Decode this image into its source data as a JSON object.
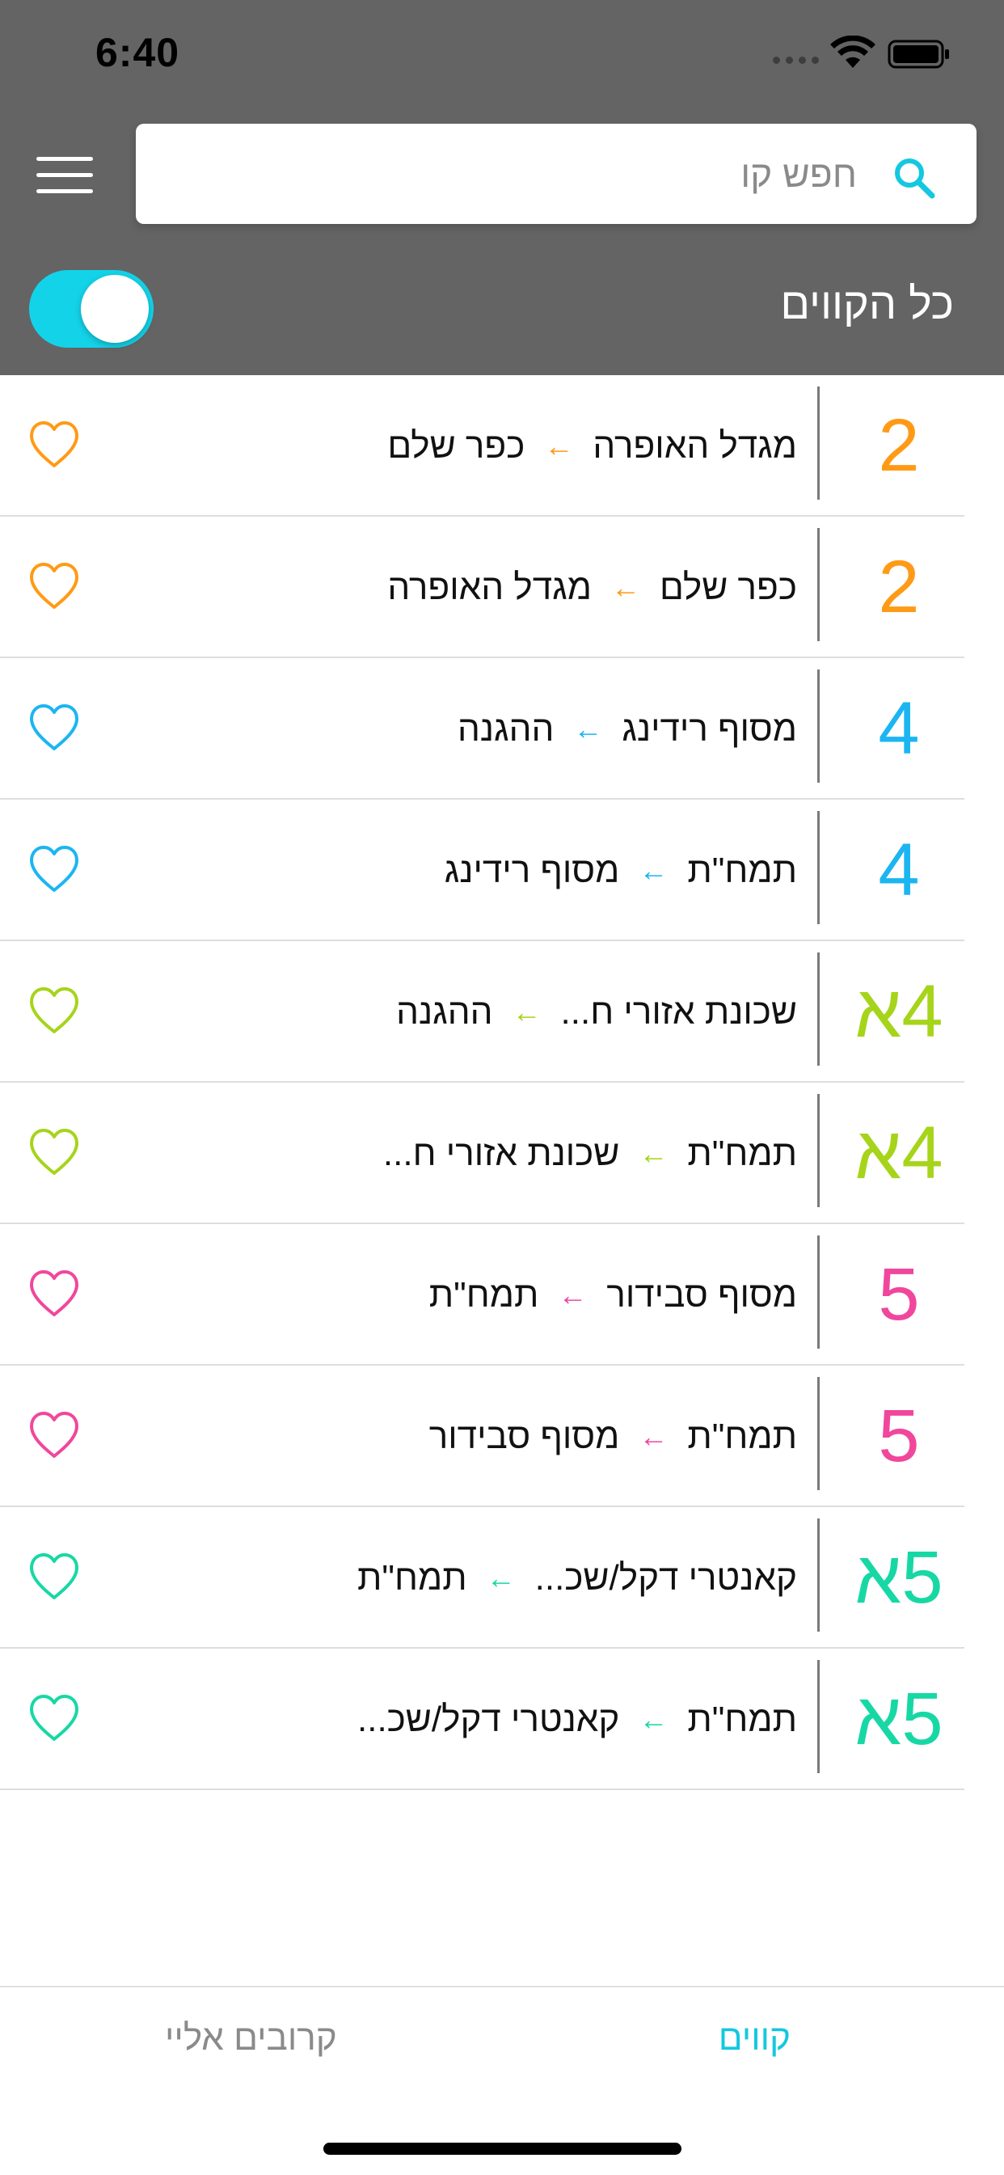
{
  "status_bar": {
    "time": "6:40"
  },
  "search": {
    "placeholder": "חפש קו",
    "value": "",
    "icon": "search-icon"
  },
  "filter": {
    "label": "כל הקווים",
    "toggle_on": true
  },
  "colors": {
    "header_bg": "#646464",
    "accent": "#13d3e9",
    "line_2": "#ff9a16",
    "line_4": "#1cb5f2",
    "line_4a": "#a6d41a",
    "line_5": "#f0479c",
    "line_5a": "#17d8a5"
  },
  "lines": [
    {
      "number": "2",
      "from": "מגדל האופרה",
      "to": "כפר שלם",
      "color": "#ff9a16"
    },
    {
      "number": "2",
      "from": "כפר שלם",
      "to": "מגדל האופרה",
      "color": "#ff9a16"
    },
    {
      "number": "4",
      "from": "מסוף רידינג",
      "to": "ההגנה",
      "color": "#1cb5f2"
    },
    {
      "number": "4",
      "from": "תמח\"ת",
      "to": "מסוף רידינג",
      "color": "#1cb5f2"
    },
    {
      "number": "4א",
      "from": "שכונת אזורי ח...",
      "to": "ההגנה",
      "color": "#a6d41a"
    },
    {
      "number": "4א",
      "from": "תמח\"ת",
      "to": "שכונת אזורי ח...",
      "color": "#a6d41a"
    },
    {
      "number": "5",
      "from": "מסוף סבידור",
      "to": "תמח\"ת",
      "color": "#f0479c"
    },
    {
      "number": "5",
      "from": "תמח\"ת",
      "to": "מסוף סבידור",
      "color": "#f0479c"
    },
    {
      "number": "5א",
      "from": "קאנטרי דקל/שכ...",
      "to": "תמח\"ת",
      "color": "#17d8a5"
    },
    {
      "number": "5א",
      "from": "תמח\"ת",
      "to": "קאנטרי דקל/שכ...",
      "color": "#17d8a5"
    }
  ],
  "arrow_glyph": "←",
  "tabs": {
    "lines": "קווים",
    "nearby": "קרובים אליי",
    "active": "lines"
  }
}
